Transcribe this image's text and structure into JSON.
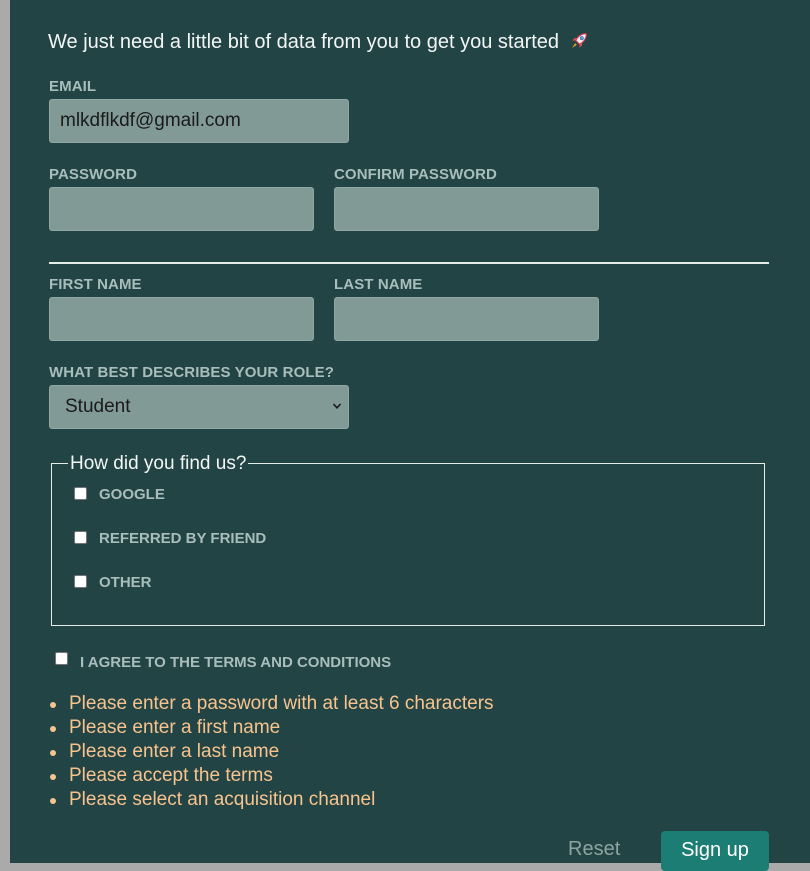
{
  "form": {
    "intro_text": "We just need a little bit of data from you to get you started",
    "email": {
      "label": "EMAIL",
      "value": "mlkdflkdf@gmail.com"
    },
    "password": {
      "label": "PASSWORD",
      "value": ""
    },
    "confirm_password": {
      "label": "CONFIRM PASSWORD",
      "value": ""
    },
    "first_name": {
      "label": "FIRST NAME",
      "value": ""
    },
    "last_name": {
      "label": "LAST NAME",
      "value": ""
    },
    "role": {
      "label": "WHAT BEST DESCRIBES YOUR ROLE?",
      "selected": "Student"
    },
    "acquisition": {
      "legend": "How did you find us?",
      "options": [
        {
          "label": "GOOGLE",
          "checked": false
        },
        {
          "label": "REFERRED BY FRIEND",
          "checked": false
        },
        {
          "label": "OTHER",
          "checked": false
        }
      ]
    },
    "terms": {
      "label": "I AGREE TO THE TERMS AND CONDITIONS",
      "checked": false
    },
    "errors": [
      "Please enter a password with at least 6 characters",
      "Please enter a first name",
      "Please enter a last name",
      "Please accept the terms",
      "Please select an acquisition channel"
    ],
    "buttons": {
      "reset": "Reset",
      "signup": "Sign up"
    }
  },
  "icons": {
    "intro": "rocket-icon",
    "select": "chevron-down-icon"
  },
  "colors": {
    "background": "#224444",
    "input": "#829a96",
    "label": "#a9bdbc",
    "error": "#f7c48f",
    "primary_button": "#1c7d74"
  }
}
